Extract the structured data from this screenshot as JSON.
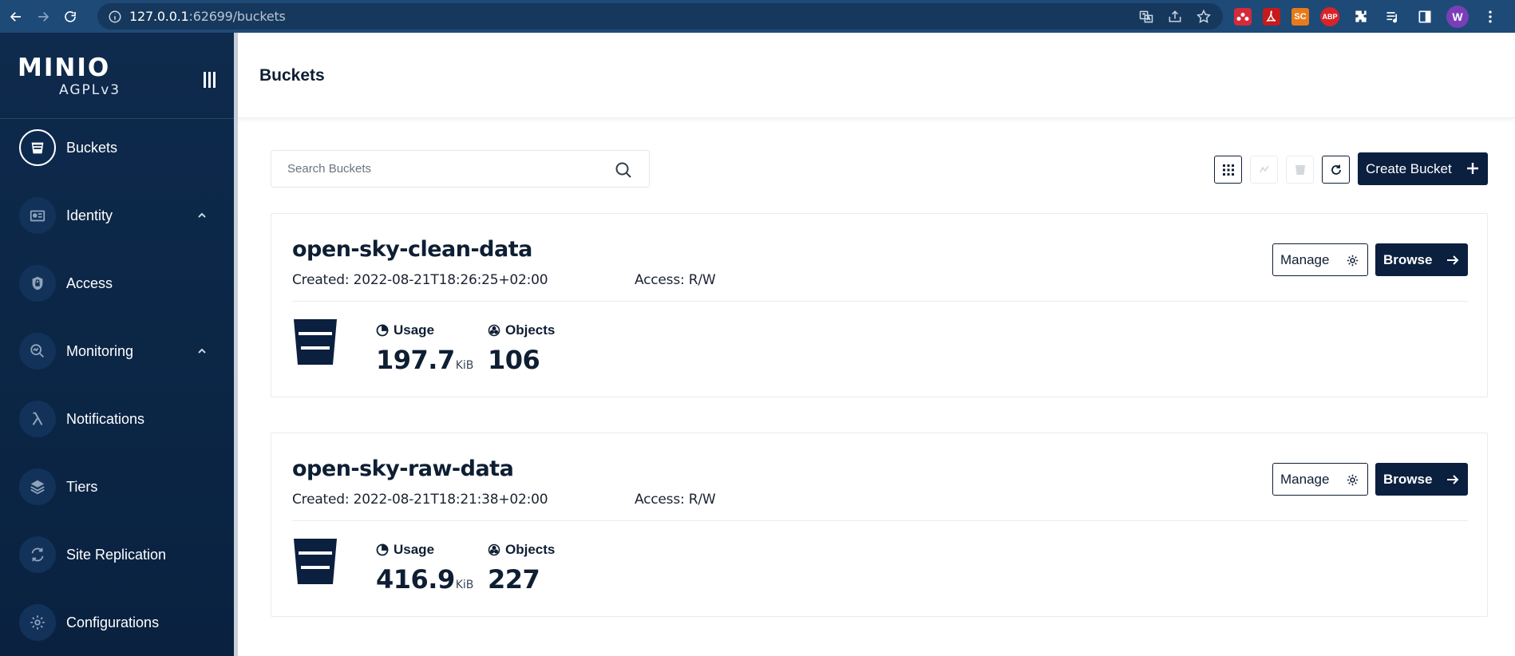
{
  "browser": {
    "url_host": "127.0.0.1",
    "url_port_path": ":62699/buckets",
    "avatar_letter": "W",
    "extensions": [
      "mendeley-icon",
      "pdf-icon",
      "sc-icon",
      "abp-icon"
    ],
    "ext_sc_label": "SC",
    "ext_abp_label": "ABP"
  },
  "sidebar": {
    "logo": "MINIO",
    "license": "AGPLv3",
    "items": [
      {
        "label": "Buckets",
        "icon": "bucket-icon",
        "active": true
      },
      {
        "label": "Identity",
        "icon": "identity-icon",
        "chevron": true
      },
      {
        "label": "Access",
        "icon": "lock-icon"
      },
      {
        "label": "Monitoring",
        "icon": "monitoring-icon",
        "chevron": true
      },
      {
        "label": "Notifications",
        "icon": "lambda-icon"
      },
      {
        "label": "Tiers",
        "icon": "layers-icon"
      },
      {
        "label": "Site Replication",
        "icon": "replication-icon"
      },
      {
        "label": "Configurations",
        "icon": "gear-icon"
      }
    ]
  },
  "header": {
    "title": "Buckets"
  },
  "toolbar": {
    "search_placeholder": "Search Buckets",
    "create_label": "Create Bucket"
  },
  "buckets": [
    {
      "name": "open-sky-clean-data",
      "created": "Created: 2022-08-21T18:26:25+02:00",
      "access": "Access: R/W",
      "usage_label": "Usage",
      "usage_value": "197.7",
      "usage_unit": "KiB",
      "objects_label": "Objects",
      "objects_value": "106",
      "manage_label": "Manage",
      "browse_label": "Browse"
    },
    {
      "name": "open-sky-raw-data",
      "created": "Created: 2022-08-21T18:21:38+02:00",
      "access": "Access: R/W",
      "usage_label": "Usage",
      "usage_value": "416.9",
      "usage_unit": "KiB",
      "objects_label": "Objects",
      "objects_value": "227",
      "manage_label": "Manage",
      "browse_label": "Browse"
    }
  ],
  "colors": {
    "sidebar_bg": "#0e2a4c",
    "primary": "#0b1f3f",
    "browser_bar": "#1e4a78"
  }
}
